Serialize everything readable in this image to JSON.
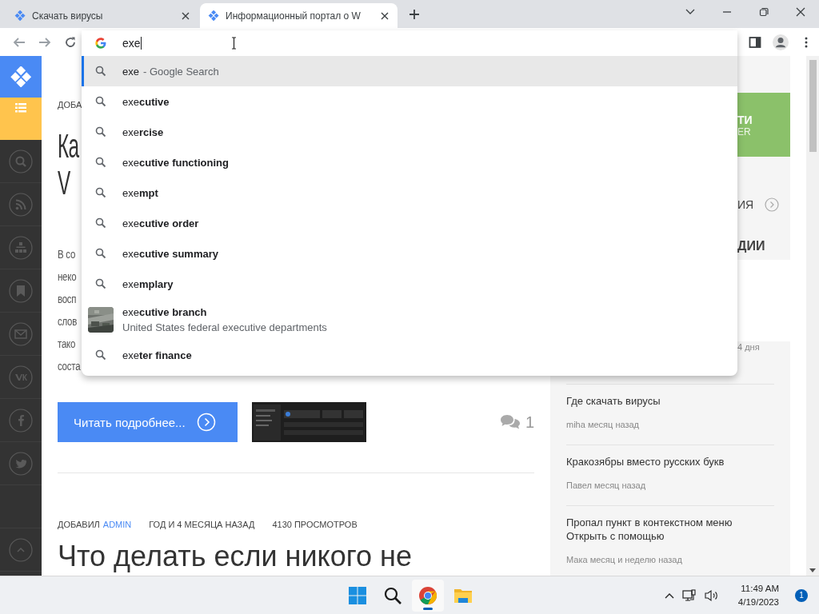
{
  "tabs": [
    {
      "title": "Скачать вирусы",
      "selected": false
    },
    {
      "title": "Информационный портал о W",
      "selected": true
    }
  ],
  "omnibox": {
    "value": "exe"
  },
  "suggestions": [
    {
      "kind": "search",
      "text": "exe",
      "detail": "- Google Search",
      "selected": true
    },
    {
      "kind": "search",
      "text": "exe**cutive**",
      "selected": false
    },
    {
      "kind": "search",
      "text": "exe**rcise**",
      "selected": false
    },
    {
      "kind": "search",
      "text": "exe**cutive functioning**",
      "selected": false
    },
    {
      "kind": "search",
      "text": "exe**mpt**",
      "selected": false
    },
    {
      "kind": "search",
      "text": "exe**cutive order**",
      "selected": false
    },
    {
      "kind": "search",
      "text": "exe**cutive summary**",
      "selected": false
    },
    {
      "kind": "search",
      "text": "exe**mplary**",
      "selected": false
    },
    {
      "kind": "entity",
      "text": "exe**cutive branch**",
      "detail": "United States federal executive departments",
      "selected": false
    },
    {
      "kind": "search",
      "text": "exe**ter finance**",
      "selected": false
    }
  ],
  "article_1": {
    "meta": "ДОБА",
    "title_lines": [
      "Ка",
      "V"
    ],
    "text_lines": [
      "В со",
      "неко",
      "восп",
      "слов",
      "тако",
      "соста"
    ],
    "read_more": "Читать подробнее...",
    "thumbnail": {
      "kind": "picture"
    },
    "comments": "1"
  },
  "article_2": {
    "author_label": "ДОБАВИЛ",
    "author": "ADMIN",
    "age": "ГОД И 4 МЕСЯЦА НАЗАД",
    "views": "4130 ПРОСМОТРОВ",
    "title": "Что делать если никого не"
  },
  "aside": {
    "promo_title": "ТИ",
    "promo_sub": "ER",
    "link": "ИЯ",
    "heading": "ДИИ",
    "fragment": "4 дня",
    "comments": [
      {
        "title": "Где скачать вирусы",
        "meta": "miha месяц назад"
      },
      {
        "title": "Кракозябры вместо русских букв",
        "meta": "Павел месяц назад"
      },
      {
        "title": "Пропал пункт в контекстном меню Открыть с помощью",
        "meta": "Мака месяц и неделю назад"
      }
    ]
  },
  "taskbar": {
    "apps": [
      {
        "kind": "start",
        "selected": false
      },
      {
        "kind": "search",
        "selected": false
      },
      {
        "kind": "chrome",
        "selected": true
      },
      {
        "kind": "folder",
        "selected": false
      }
    ],
    "time": "11:49 AM",
    "date": "4/19/2023",
    "notifications": "1"
  }
}
